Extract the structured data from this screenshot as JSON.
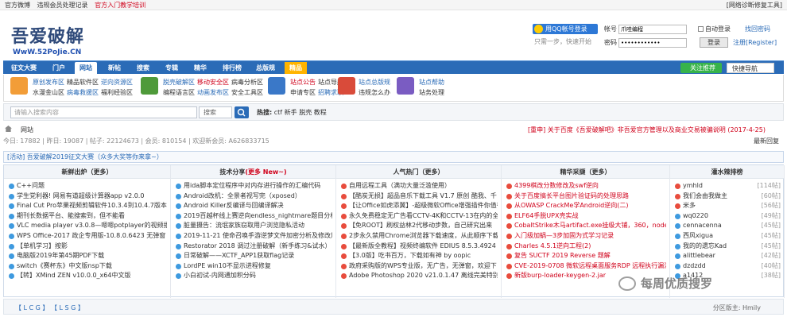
{
  "topbar": {
    "left": [
      "官方微博",
      "违规会员处理记录",
      "官方入门教学培训"
    ],
    "right": "[网络诊断修复工具]"
  },
  "logo": {
    "cn": "吾爱破解",
    "en": "WwW.52PoJie.CN"
  },
  "login": {
    "qq_button": "用QQ帐号登录",
    "qq_sub": "只需一步，快速开始",
    "user_label": "帐号",
    "user_value": "爪哇编程",
    "pass_label": "密码",
    "pass_value": "••••••••••••",
    "auto": "自动登录",
    "find": "找回密码",
    "login_btn": "登录",
    "register": "注册[Register]"
  },
  "nav": {
    "items": [
      "征文大赛",
      "门户",
      "网站",
      "新帖",
      "搜索",
      "专辑",
      "精华",
      "排行榜",
      "总版规",
      "精品"
    ],
    "hot_rec": "关注推荐",
    "quick": "快捷导航"
  },
  "subnav": [
    {
      "rows": [
        [
          "原创发布区",
          "精品软件区",
          "逆向资源区"
        ],
        [
          "水漫金山区",
          "病毒救援区",
          "福利经验区"
        ]
      ],
      "color": "#f29d38"
    },
    {
      "rows": [
        [
          "脱壳破解区",
          "移动安全区",
          "病毒分析区"
        ],
        [
          "编程语言区",
          "动画发布区",
          "安全工具区"
        ]
      ],
      "color": "#4f9a3a"
    },
    {
      "rows": [
        [
          "站点公告",
          "站点导航"
        ],
        [
          "申请专区",
          "招聘求职"
        ]
      ],
      "color": "#3a78c8"
    },
    {
      "rows": [
        [
          "站点总版规"
        ],
        [
          "违规怎么办"
        ]
      ],
      "color": "#d94b3a"
    },
    {
      "rows": [
        [
          "站点帮助"
        ],
        [
          "站务处理"
        ]
      ],
      "color": "#7a5cc2"
    }
  ],
  "search": {
    "placeholder": "请输入搜索内容",
    "select": "搜索",
    "hot_label": "热搜:",
    "hot": [
      "ctf",
      "新手",
      "脱壳",
      "教程"
    ]
  },
  "crumb": {
    "home": "网站",
    "notice": "[重申] 关于百度《吾爱破解吧》非吾爱官方管理以及商业交易被骗说明 (2017-4-25)"
  },
  "stats": {
    "text": "今日: 17882 | 昨日: 19087 | 帖子: 22124673 | 会员: 810154 | 欢迎新会员: A626833715",
    "right": "最新回复"
  },
  "activity": "[活动] 吾爱破解2019征文大赛（众多大奖等你来拿~）",
  "columns": [
    {
      "title": "新鲜出炉（更多）",
      "items": [
        "C++问题",
        "学生党利器! 网易有道超级计算器app v2.0.0",
        "Final Cut Pro苹果视频剪辑软件10.3.4到10.4.7版本",
        "期刊长数据平台、能搜索到，但不能看",
        "VLC media player v3.0.8—嗯嗯potplayer的视频播放",
        "WPS Office-2017 政企专用版-10.8.0.6423 无弹窗 全功",
        "【单机学习】按影",
        "电脑版2019年第45期PDF下载",
        "switch《赛杯东》中文版nsp下载",
        "【转】XMind ZEN v10.0.0_x64中文版"
      ],
      "dots": [
        "#3e9adf",
        "#3e9adf",
        "#3e9adf",
        "#3e9adf",
        "#3e9adf",
        "#3e9adf",
        "#3e9adf",
        "#3e9adf",
        "#3e9adf",
        "#3e9adf"
      ]
    },
    {
      "title": "技术分享",
      "more": "(更多 New~)",
      "items": [
        "用ida脚本定位程序中对内存进行操作的汇编代码",
        "Android改机：全景者视写完（xposed）",
        "Android Killer反编译与回编译解决",
        "2019百越杯线上赛逆向endless_nightmare题目分析",
        "脏量摄告：流氓家族窃取用户浏览隐私活动",
        "2019-11-21 使命召唤手游逆梦文件加密分析及修改加",
        "Restorator 2018 调过注册破解（新手练习&试水）",
        "日常破解——XCTF_APP1获取flag记录",
        "LordPE win10不显示进程修复",
        "小白初试-内网通加积分码"
      ],
      "dots": [
        "#3e9adf",
        "#3e9adf",
        "#3e9adf",
        "#3e9adf",
        "#3e9adf",
        "#3e9adf",
        "#3e9adf",
        "#3e9adf",
        "#3e9adf",
        "#3e9adf"
      ]
    },
    {
      "title": "人气热门（更多）",
      "items": [
        "自用远程工具（满功大量泛滥使用）",
        "【酷炭无损】超品音乐下载工具 V1.7 原创 酷我、千",
        "【让Office如虎添翼】-超级微软Office增强插件你值得",
        "永久免费稳定无广告看CCTV-4K和CCTV-13在内的全套",
        "【免ROOT】刷权益林2代移动步数，自己研究出来",
        "2步永久禁用Chrome浏览器下载速度，从此顺序下载",
        "【最新版全教程】视频终编软件 EDIUS 8.5.3.4924 一键",
        "【3.0版】吃书百万，下载如有神 by oopic",
        "政府采购版的WPS专业版，无广告，无弹窗，欢迎下",
        "Adobe Photoshop 2020 v21.0.1.47 离线完美特别版"
      ],
      "dots": [
        "#e84c3d",
        "#e84c3d",
        "#e84c3d",
        "#e84c3d",
        "#e84c3d",
        "#e84c3d",
        "#e84c3d",
        "#e84c3d",
        "#e84c3d",
        "#e84c3d"
      ]
    },
    {
      "title": "精华采撷（更多）",
      "items": [
        "4399棋改分数修改及swf逆向",
        "关于百度搞长平台图片验证码的处理思路",
        "从OWASP CrackMe学Android逆向(二)",
        "ELF64手脱UPX壳实战",
        "CobaltStrike木马artifact.exe挂级大铺，360，node3",
        "入门级加蜗—3步加固为式学习记录",
        "Charles 4.5.1逆向工程(2)",
        "复告 SUCTF 2019 Reverse 题解",
        "CVE-2019-0708 微软远程桌面服务RDP 远程执行漏洞",
        "新版burp-loader-keygen-2.jar"
      ],
      "dots": [
        "#e84c3d",
        "#e84c3d",
        "#e84c3d",
        "#e84c3d",
        "#e84c3d",
        "#e84c3d",
        "#e84c3d",
        "#e84c3d",
        "#e84c3d",
        "#e84c3d"
      ]
    },
    {
      "title": "灌水辣排榜",
      "items": [
        [
          "ymhld",
          "[114帖]"
        ],
        [
          "我们会由我做主",
          "[60帖]"
        ],
        [
          "米多",
          "[56帖]"
        ],
        [
          "wq0220",
          "[49帖]"
        ],
        [
          "cennacenna",
          "[45帖]"
        ],
        [
          "西风xigua",
          "[45帖]"
        ],
        [
          "我的的遗忘Kad",
          "[45帖]"
        ],
        [
          "alittlebear",
          "[42帖]"
        ],
        [
          "dzdzdd",
          "[40帖]"
        ],
        [
          "a1412",
          "[38帖]"
        ]
      ],
      "dots": [
        "#e84c3d",
        "#e84c3d",
        "#e84c3d",
        "#3e9adf",
        "#3e9adf",
        "#3e9adf",
        "#3e9adf",
        "#3e9adf",
        "#3e9adf",
        "#3e9adf"
      ]
    }
  ],
  "footer": {
    "left": "【 L C G 】 【 L S G 】",
    "right": "分区版主: Hmily"
  },
  "watermark": "每周优质搜罗"
}
